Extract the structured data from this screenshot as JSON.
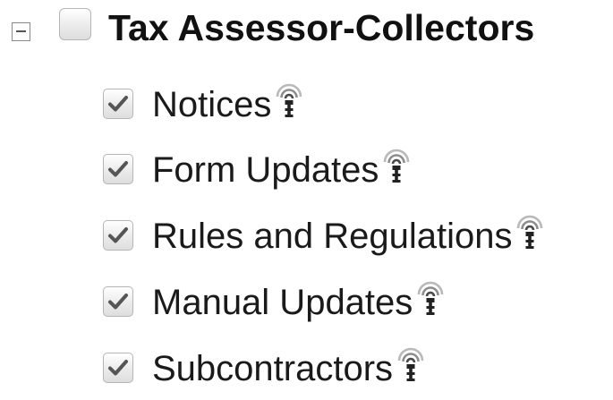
{
  "group": {
    "title": "Tax Assessor-Collectors",
    "expanded": true,
    "checked": false
  },
  "items": [
    {
      "label": "Notices",
      "checked": true,
      "icon": "rss-feed-icon"
    },
    {
      "label": "Form Updates",
      "checked": true,
      "icon": "rss-feed-icon"
    },
    {
      "label": "Rules and Regulations",
      "checked": true,
      "icon": "rss-feed-icon"
    },
    {
      "label": "Manual Updates",
      "checked": true,
      "icon": "rss-feed-icon"
    },
    {
      "label": "Subcontractors",
      "checked": true,
      "icon": "rss-feed-icon"
    }
  ],
  "colors": {
    "text": "#1a1a1a",
    "checkmark": "#555555",
    "checkbox_border": "#b5b5b5"
  }
}
